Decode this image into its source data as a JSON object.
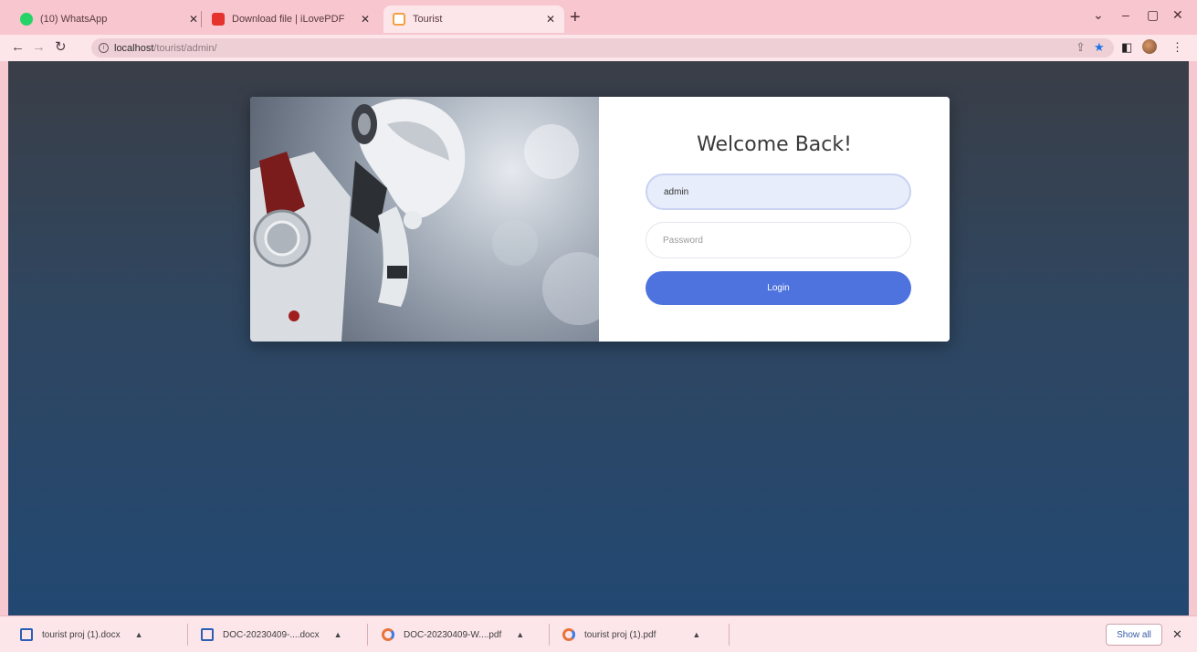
{
  "browser": {
    "tabs": [
      {
        "title": "(10) WhatsApp",
        "icon": "whatsapp-icon",
        "icon_color": "#25d366",
        "active": false
      },
      {
        "title": "Download file | iLovePDF",
        "icon": "ilovepdf-icon",
        "icon_color": "#e5322d",
        "active": false
      },
      {
        "title": "Tourist",
        "icon": "page-icon",
        "icon_color": "#f0a040",
        "active": true
      }
    ],
    "new_tab": "+",
    "window_controls": {
      "minimize": "–",
      "maximize": "▢",
      "close": "✕",
      "tab_search": "⌄"
    },
    "url": {
      "host": "localhost",
      "path": "/tourist/admin/"
    }
  },
  "login": {
    "heading": "Welcome Back!",
    "username_value": "admin",
    "password_placeholder": "Password",
    "login_label": "Login",
    "accent_color": "#4e73df"
  },
  "downloads": {
    "items": [
      {
        "name": "tourist proj (1).docx",
        "type": "docx"
      },
      {
        "name": "DOC-20230409-....docx",
        "type": "docx"
      },
      {
        "name": "DOC-20230409-W....pdf",
        "type": "pdf"
      },
      {
        "name": "tourist proj (1).pdf",
        "type": "pdf"
      }
    ],
    "show_all_label": "Show all",
    "close": "✕"
  }
}
